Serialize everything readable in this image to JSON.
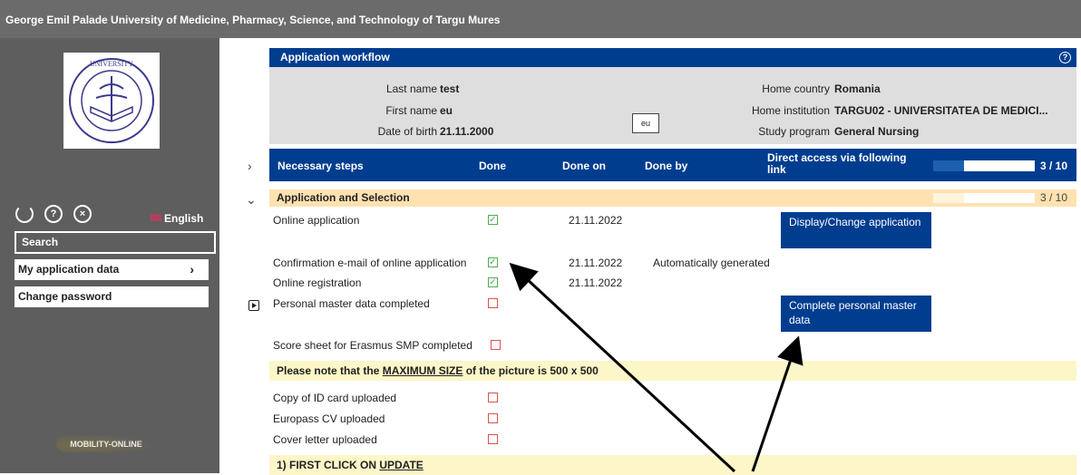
{
  "topbar": {
    "title": "George Emil Palade University of Medicine, Pharmacy, Science, and Technology of Targu Mures"
  },
  "sidebar": {
    "language": "English",
    "search_label": "Search",
    "my_application_label": "My application data",
    "change_password_label": "Change password",
    "mobility_logo_text": "MOBILITY-ONLINE",
    "logo_text": "UNIVERSITY"
  },
  "workflow": {
    "title": "Application workflow",
    "help_icon": "?",
    "last_name_label": "Last name",
    "last_name": "test",
    "first_name_label": "First name",
    "first_name": "eu",
    "dob_label": "Date of birth",
    "dob": "21.11.2000",
    "eu_badge": "eu",
    "home_country_label": "Home country",
    "home_country": "Romania",
    "home_institution_label": "Home institution",
    "home_institution": "TARGU02 - UNIVERSITATEA DE MEDICI...",
    "study_program_label": "Study program",
    "study_program": "General Nursing"
  },
  "steps_header": {
    "col_steps": "Necessary steps",
    "col_done": "Done",
    "col_done_on": "Done on",
    "col_done_by": "Done by",
    "col_direct": "Direct access via following link",
    "progress": "3 / 10",
    "progress_fraction": 0.3
  },
  "section": {
    "title": "Application and Selection",
    "progress": "3 / 10"
  },
  "steps": [
    {
      "label": "Online application",
      "done": true,
      "date": "21.11.2022",
      "by": "",
      "button": "Display/Change application"
    },
    {
      "label": "Confirmation e-mail of online application",
      "done": true,
      "date": "21.11.2022",
      "by": "Automatically generated"
    },
    {
      "label": "Online registration",
      "done": true,
      "date": "21.11.2022",
      "by": ""
    },
    {
      "label": "Personal master data completed",
      "done": false,
      "date": "",
      "by": "",
      "button": "Complete personal master data"
    },
    {
      "label": "Score sheet for Erasmus SMP completed",
      "done": false
    },
    {
      "label": "Copy of ID card uploaded",
      "done": false
    },
    {
      "label": "Europass CV uploaded",
      "done": false
    },
    {
      "label": "Cover letter uploaded",
      "done": false
    }
  ],
  "notes": {
    "picture_pre": "Please note that the ",
    "picture_link": "MAXIMUM SIZE",
    "picture_post": " of the picture is 500 x 500",
    "update_pre": "1) FIRST CLICK ON ",
    "update_link": "UPDATE"
  },
  "colors": {
    "header_blue": "#003d8f",
    "sidebar_gray": "#5e5e5e",
    "section_orange": "#ffe2b0",
    "note_yellow": "#fdf6c8",
    "check_green": "#4caf50",
    "box_red": "#d9534f"
  }
}
